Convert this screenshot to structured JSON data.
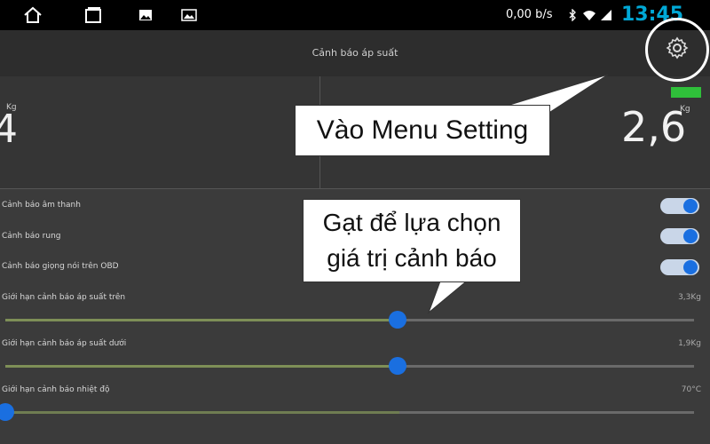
{
  "status_bar": {
    "net_speed": "0,00 b/s",
    "time": "13:45",
    "icons": [
      "home-icon",
      "recents-icon",
      "image-icon",
      "image-icon",
      "bluetooth-icon",
      "wifi-icon",
      "signal-icon"
    ]
  },
  "header": {
    "title": "Cảnh báo áp suất",
    "settings_icon": "gear-icon"
  },
  "pressure": {
    "left_value": "4",
    "left_unit": "Kg",
    "right_value": "2,6",
    "right_unit": "Kg"
  },
  "settings": {
    "toggles": [
      {
        "label": "Cảnh báo âm thanh",
        "on": true
      },
      {
        "label": "Cảnh báo rung",
        "on": true
      },
      {
        "label": "Cảnh báo giọng nói trên OBD",
        "on": true
      }
    ],
    "sliders": [
      {
        "label": "Giới hạn cảnh báo áp suất trên",
        "value": "3,3Kg",
        "fraction": 0.57
      },
      {
        "label": "Giới hạn cảnh báo áp suất dưới",
        "value": "1,9Kg",
        "fraction": 0.57
      },
      {
        "label": "Giới hạn cảnh báo nhiệt độ",
        "value": "70°C",
        "fraction": 0.0
      }
    ]
  },
  "callouts": {
    "menu": "Vào Menu Setting",
    "slide_line1": "Gạt để lựa chọn",
    "slide_line2": "giá trị cảnh báo"
  },
  "colors": {
    "accent": "#1a6fe0",
    "clock": "#00a8d6",
    "battery": "#2fbf3a"
  }
}
